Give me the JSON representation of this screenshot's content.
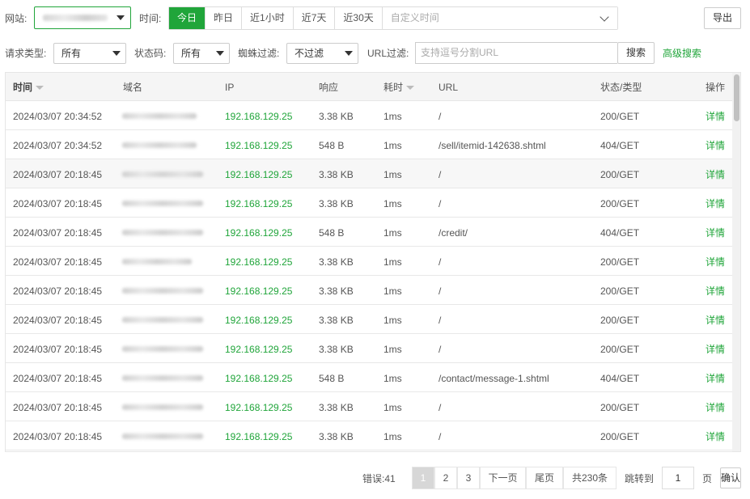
{
  "toolbar": {
    "site_label": "网站:",
    "time_label": "时间:",
    "time_ranges": [
      "今日",
      "昨日",
      "近1小时",
      "近7天",
      "近30天"
    ],
    "custom_time_placeholder": "自定义时间",
    "export_label": "导出"
  },
  "filters": {
    "request_type_label": "请求类型:",
    "request_type_value": "所有",
    "status_code_label": "状态码:",
    "status_code_value": "所有",
    "spider_filter_label": "蜘蛛过滤:",
    "spider_filter_value": "不过滤",
    "url_filter_label": "URL过滤:",
    "url_filter_placeholder": "支持逗号分割URL",
    "search_label": "搜索",
    "advanced_search_label": "高级搜索"
  },
  "table": {
    "columns": [
      "时间",
      "域名",
      "IP",
      "响应",
      "耗时",
      "URL",
      "状态/类型",
      "操作"
    ],
    "rows": [
      {
        "time": "2024/03/07 20:34:52",
        "ip": "192.168.129.25",
        "size": "3.38 KB",
        "cost": "1ms",
        "url": "/",
        "status": "200/GET",
        "action": "详情"
      },
      {
        "time": "2024/03/07 20:34:52",
        "ip": "192.168.129.25",
        "size": "548 B",
        "cost": "1ms",
        "url": "/sell/itemid-142638.shtml",
        "status": "404/GET",
        "action": "详情"
      },
      {
        "time": "2024/03/07 20:18:45",
        "ip": "192.168.129.25",
        "size": "3.38 KB",
        "cost": "1ms",
        "url": "/",
        "status": "200/GET",
        "action": "详情"
      },
      {
        "time": "2024/03/07 20:18:45",
        "ip": "192.168.129.25",
        "size": "3.38 KB",
        "cost": "1ms",
        "url": "/",
        "status": "200/GET",
        "action": "详情"
      },
      {
        "time": "2024/03/07 20:18:45",
        "ip": "192.168.129.25",
        "size": "548 B",
        "cost": "1ms",
        "url": "/credit/",
        "status": "404/GET",
        "action": "详情"
      },
      {
        "time": "2024/03/07 20:18:45",
        "ip": "192.168.129.25",
        "size": "3.38 KB",
        "cost": "1ms",
        "url": "/",
        "status": "200/GET",
        "action": "详情"
      },
      {
        "time": "2024/03/07 20:18:45",
        "ip": "192.168.129.25",
        "size": "3.38 KB",
        "cost": "1ms",
        "url": "/",
        "status": "200/GET",
        "action": "详情"
      },
      {
        "time": "2024/03/07 20:18:45",
        "ip": "192.168.129.25",
        "size": "3.38 KB",
        "cost": "1ms",
        "url": "/",
        "status": "200/GET",
        "action": "详情"
      },
      {
        "time": "2024/03/07 20:18:45",
        "ip": "192.168.129.25",
        "size": "3.38 KB",
        "cost": "1ms",
        "url": "/",
        "status": "200/GET",
        "action": "详情"
      },
      {
        "time": "2024/03/07 20:18:45",
        "ip": "192.168.129.25",
        "size": "548 B",
        "cost": "1ms",
        "url": "/contact/message-1.shtml",
        "status": "404/GET",
        "action": "详情"
      },
      {
        "time": "2024/03/07 20:18:45",
        "ip": "192.168.129.25",
        "size": "3.38 KB",
        "cost": "1ms",
        "url": "/",
        "status": "200/GET",
        "action": "详情"
      },
      {
        "time": "2024/03/07 20:18:45",
        "ip": "192.168.129.25",
        "size": "3.38 KB",
        "cost": "1ms",
        "url": "/",
        "status": "200/GET",
        "action": "详情"
      }
    ]
  },
  "pagination": {
    "errors_label": "错误:41",
    "pages": [
      "1",
      "2",
      "3"
    ],
    "next_label": "下一页",
    "last_label": "尾页",
    "total_label": "共230条",
    "goto_label": "跳转到",
    "goto_value": "1",
    "page_unit": "页",
    "confirm_label": "确认"
  },
  "colors": {
    "accent": "#20a53a",
    "header_bg": "#f5f5f5"
  }
}
